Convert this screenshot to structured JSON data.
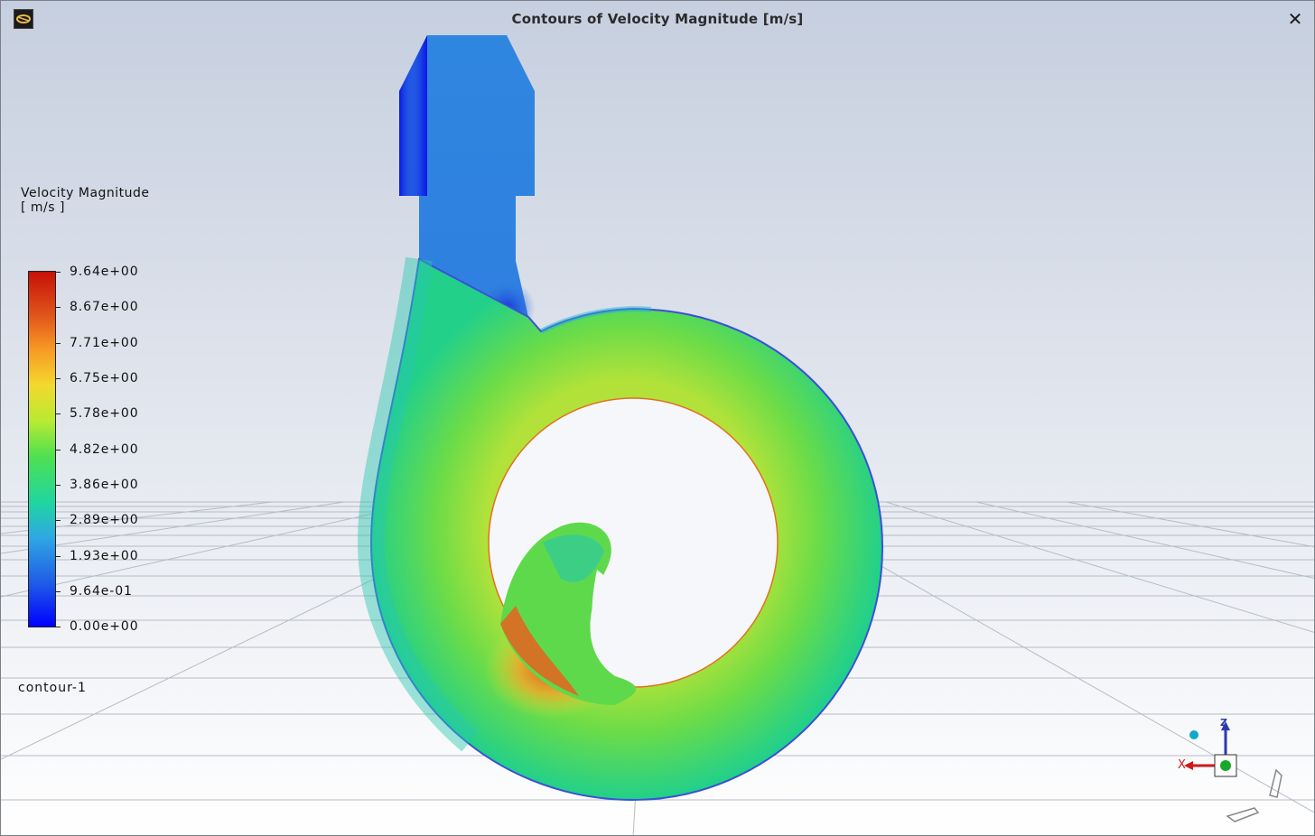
{
  "window": {
    "title": "Contours of Velocity Magnitude [m/s]",
    "close_label": "✕"
  },
  "legend": {
    "title_line1": "Velocity Magnitude",
    "title_line2": "[ m/s ]",
    "ticks": [
      "9.64e+00",
      "8.67e+00",
      "7.71e+00",
      "6.75e+00",
      "5.78e+00",
      "4.82e+00",
      "3.86e+00",
      "2.89e+00",
      "1.93e+00",
      "9.64e-01",
      "0.00e+00"
    ],
    "colormap": [
      "#0000ff",
      "#1f5ae6",
      "#2fa7e3",
      "#1fd6a0",
      "#4fe050",
      "#b9ea32",
      "#f3d92d",
      "#f79a25",
      "#e0531b",
      "#c51107"
    ]
  },
  "contour_name": "contour-1",
  "triad": {
    "z_label": "Z",
    "x_label": "X"
  },
  "colors": {
    "background_top": "#c8d0e0",
    "background_bottom": "#ffffff",
    "grid": "#b9bcc4"
  }
}
